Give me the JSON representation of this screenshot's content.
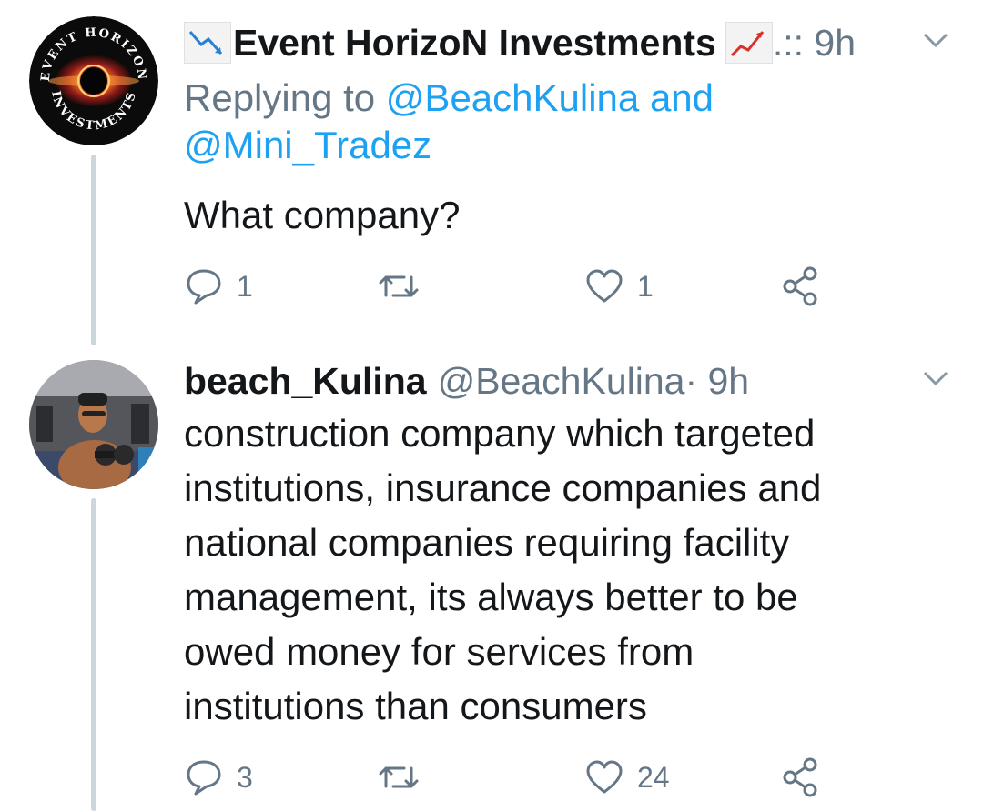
{
  "tweets": [
    {
      "display_name": "Event HorizoN Investments",
      "meta": " .:: 9h",
      "replying_to_label": "Replying to",
      "mentions": [
        "@BeachKulina",
        "@Mini_Tradez"
      ],
      "mention_join": "and",
      "text": "What company?",
      "reply_count": "1",
      "retweet_count": "",
      "like_count": "1",
      "avatar_ring_text_top": "EVENT HORIZON",
      "avatar_ring_text_bottom": "INVESTMENTS",
      "name_prefix_icon": "chart-decreasing-emoji",
      "name_suffix_icon": "chart-increasing-emoji"
    },
    {
      "display_name": "beach_Kulina",
      "handle": "@BeachKulina",
      "meta": " · 9h",
      "text_lines": [
        "construction company which targeted",
        "institutions, insurance companies and",
        "national companies requiring facility",
        "management, its always better to be",
        "owed money for services from",
        "institutions than consumers"
      ],
      "reply_count": "3",
      "retweet_count": "",
      "like_count": "24"
    }
  ],
  "icons": {
    "reply": "reply-bubble-icon",
    "retweet": "retweet-icon",
    "like": "heart-icon",
    "share": "share-nodes-icon",
    "more": "chevron-down-icon"
  },
  "colors": {
    "text": "#14171a",
    "secondary": "#657786",
    "mention": "#1da1f2",
    "thread_line": "#ccd6dd"
  }
}
